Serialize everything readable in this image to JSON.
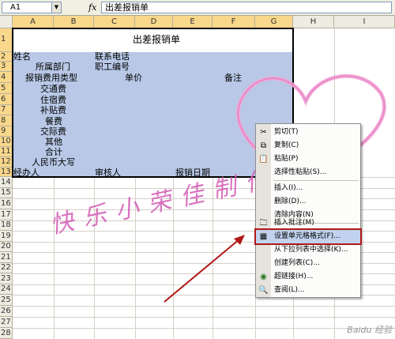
{
  "formula_bar": {
    "name_box": "A1",
    "fx": "fx",
    "content": "出差报销单"
  },
  "columns": [
    "A",
    "B",
    "C",
    "D",
    "E",
    "F",
    "G",
    "H",
    "I"
  ],
  "rows": [
    "1",
    "2",
    "3",
    "4",
    "5",
    "6",
    "7",
    "8",
    "9",
    "10",
    "11",
    "12",
    "13",
    "14",
    "15",
    "16",
    "17",
    "18",
    "19",
    "20",
    "21",
    "22",
    "23",
    "24",
    "25",
    "26",
    "27",
    "28"
  ],
  "sheet": {
    "title": "出差报销单",
    "name_label": "姓名",
    "phone_label": "联系电话",
    "dept_label": "所属部门",
    "employee_id_label": "职工编号",
    "expense_type_header": "报销费用类型",
    "unit_price_header": "单价",
    "remarks_header": "备注",
    "expense_types": [
      "交通费",
      "住宿费",
      "补贴费",
      "餐费",
      "交际费",
      "其他",
      "合计",
      "人民币大写"
    ],
    "handler_label": "经办人",
    "reviewer_label": "审核人",
    "date_label": "报销日期"
  },
  "watermark": {
    "text": "快乐小荣佳制作",
    "color": "#d35bb5"
  },
  "context_menu": {
    "items": [
      {
        "label": "剪切(T)",
        "icon": "cut-icon"
      },
      {
        "label": "复制(C)",
        "icon": "copy-icon"
      },
      {
        "label": "粘贴(P)",
        "icon": "paste-icon"
      },
      {
        "label": "选择性粘贴(S)...",
        "icon": ""
      },
      {
        "label": "插入(I)...",
        "icon": ""
      },
      {
        "label": "删除(D)...",
        "icon": ""
      },
      {
        "label": "清除内容(N)",
        "icon": ""
      },
      {
        "label": "插入批注(M)",
        "icon": "comment-icon"
      },
      {
        "label": "设置单元格格式(F)...",
        "icon": "format-cells-icon"
      },
      {
        "label": "从下拉列表中选择(K)...",
        "icon": ""
      },
      {
        "label": "创建列表(C)...",
        "icon": ""
      },
      {
        "label": "超链接(H)...",
        "icon": "hyperlink-icon"
      },
      {
        "label": "查阅(L)...",
        "icon": "lookup-icon"
      }
    ]
  },
  "footer_watermark": "Baidu 经验",
  "colors": {
    "selection": "#b8c8e6",
    "highlight_outline": "#b01818",
    "arrow": "#b01818"
  }
}
